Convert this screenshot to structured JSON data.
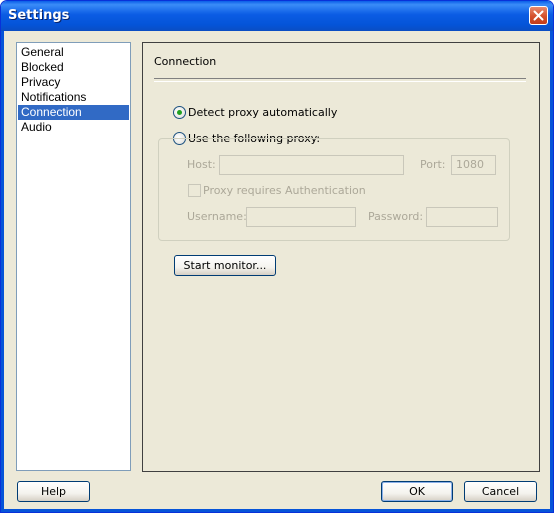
{
  "window": {
    "title": "Settings"
  },
  "sidebar": {
    "items": [
      {
        "label": "General"
      },
      {
        "label": "Blocked"
      },
      {
        "label": "Privacy"
      },
      {
        "label": "Notifications"
      },
      {
        "label": "Connection",
        "selected": true
      },
      {
        "label": "Audio"
      }
    ]
  },
  "connection": {
    "section_title": "Connection",
    "detect_proxy_label": "Detect proxy automatically",
    "detect_proxy_selected": true,
    "use_proxy_label": "Use the following proxy:",
    "use_proxy_selected": false,
    "host_label": "Host:",
    "host_value": "",
    "port_label": "Port:",
    "port_value": "1080",
    "auth_label": "Proxy requires Authentication",
    "auth_checked": false,
    "username_label": "Username:",
    "username_value": "",
    "password_label": "Password:",
    "password_value": "",
    "start_monitor_label": "Start monitor..."
  },
  "footer": {
    "help_label": "Help",
    "ok_label": "OK",
    "cancel_label": "Cancel"
  },
  "colors": {
    "titlebar": "#0a5ee8",
    "dialog_bg": "#ece9d8",
    "selection": "#316ac5",
    "close_button": "#d4502c",
    "radio_dot": "#21a121"
  }
}
